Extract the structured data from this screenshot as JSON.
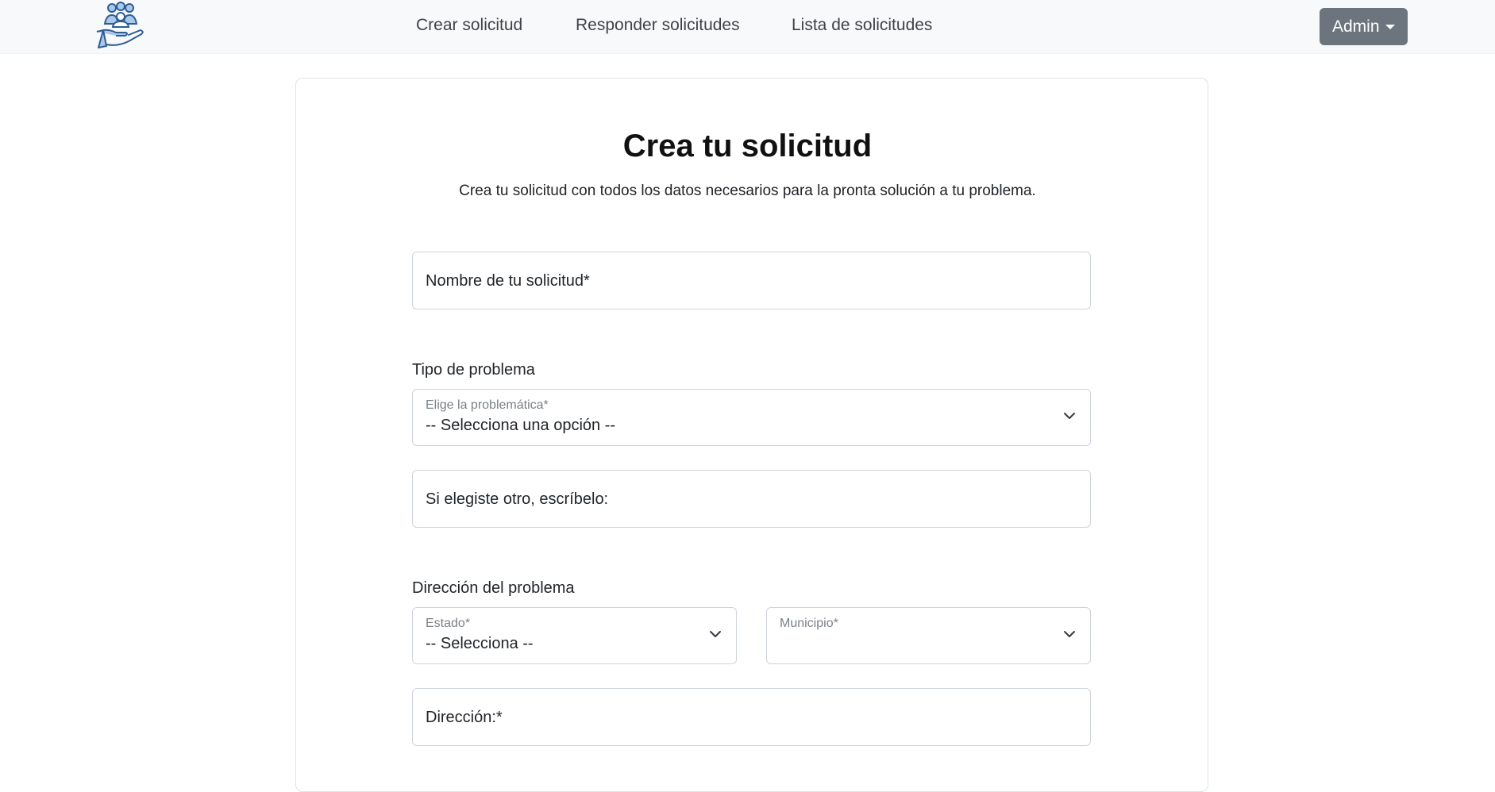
{
  "navbar": {
    "logo": "helping-hand-people-logo",
    "links": [
      {
        "label": "Crear solicitud"
      },
      {
        "label": "Responder solicitudes"
      },
      {
        "label": "Lista de solicitudes"
      }
    ],
    "user_menu": {
      "label": "Admin"
    }
  },
  "form": {
    "title": "Crea tu solicitud",
    "subtitle": "Crea tu solicitud con todos los datos necesarios para la pronta solución a tu problema.",
    "request_name": {
      "placeholder": "Nombre de tu solicitud*"
    },
    "problem_section": {
      "label": "Tipo de problema",
      "problem_type": {
        "label": "Elige la problemática*",
        "selected": "-- Selecciona una opción --"
      },
      "other_problem": {
        "placeholder": "Si elegiste otro, escríbelo:"
      }
    },
    "address_section": {
      "label": "Dirección del problema",
      "state": {
        "label": "Estado*",
        "selected": "-- Selecciona --"
      },
      "municipality": {
        "label": "Municipio*",
        "selected": ""
      },
      "address": {
        "placeholder": "Dirección:*"
      }
    }
  },
  "colors": {
    "navbar_bg": "#f8f9fa",
    "admin_button_bg": "#6c757d",
    "border": "#ced4da",
    "logo_accent": "#a9c8ec",
    "logo_stroke": "#2f5d93"
  }
}
